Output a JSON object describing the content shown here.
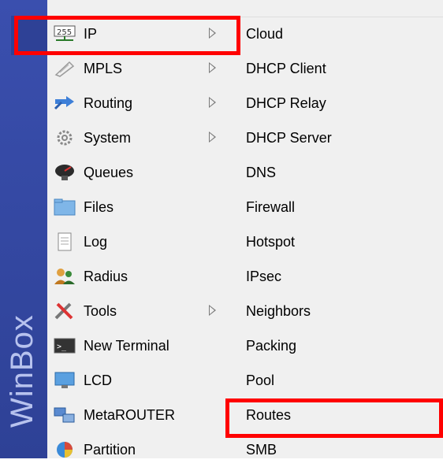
{
  "sidebar": {
    "brand": "WinBox"
  },
  "left_menu": {
    "items": [
      {
        "label": "IP",
        "icon": "ip-network-icon",
        "submenu": true
      },
      {
        "label": "MPLS",
        "icon": "mpls-icon",
        "submenu": true
      },
      {
        "label": "Routing",
        "icon": "routing-icon",
        "submenu": true
      },
      {
        "label": "System",
        "icon": "gear-icon",
        "submenu": true
      },
      {
        "label": "Queues",
        "icon": "queues-icon",
        "submenu": false
      },
      {
        "label": "Files",
        "icon": "folder-icon",
        "submenu": false
      },
      {
        "label": "Log",
        "icon": "log-icon",
        "submenu": false
      },
      {
        "label": "Radius",
        "icon": "users-icon",
        "submenu": false
      },
      {
        "label": "Tools",
        "icon": "tools-icon",
        "submenu": true
      },
      {
        "label": "New Terminal",
        "icon": "terminal-icon",
        "submenu": false
      },
      {
        "label": "LCD",
        "icon": "monitor-icon",
        "submenu": false
      },
      {
        "label": "MetaROUTER",
        "icon": "metarouter-icon",
        "submenu": false
      },
      {
        "label": "Partition",
        "icon": "pie-icon",
        "submenu": false
      }
    ]
  },
  "right_menu": {
    "items": [
      {
        "label": "Cloud"
      },
      {
        "label": "DHCP Client"
      },
      {
        "label": "DHCP Relay"
      },
      {
        "label": "DHCP Server"
      },
      {
        "label": "DNS"
      },
      {
        "label": "Firewall"
      },
      {
        "label": "Hotspot"
      },
      {
        "label": "IPsec"
      },
      {
        "label": "Neighbors"
      },
      {
        "label": "Packing"
      },
      {
        "label": "Pool"
      },
      {
        "label": "Routes"
      },
      {
        "label": "SMB"
      }
    ]
  },
  "colors": {
    "highlight": "#ff0000",
    "sidebar": "#2e4196",
    "menu_bg": "#f0f0f0"
  }
}
